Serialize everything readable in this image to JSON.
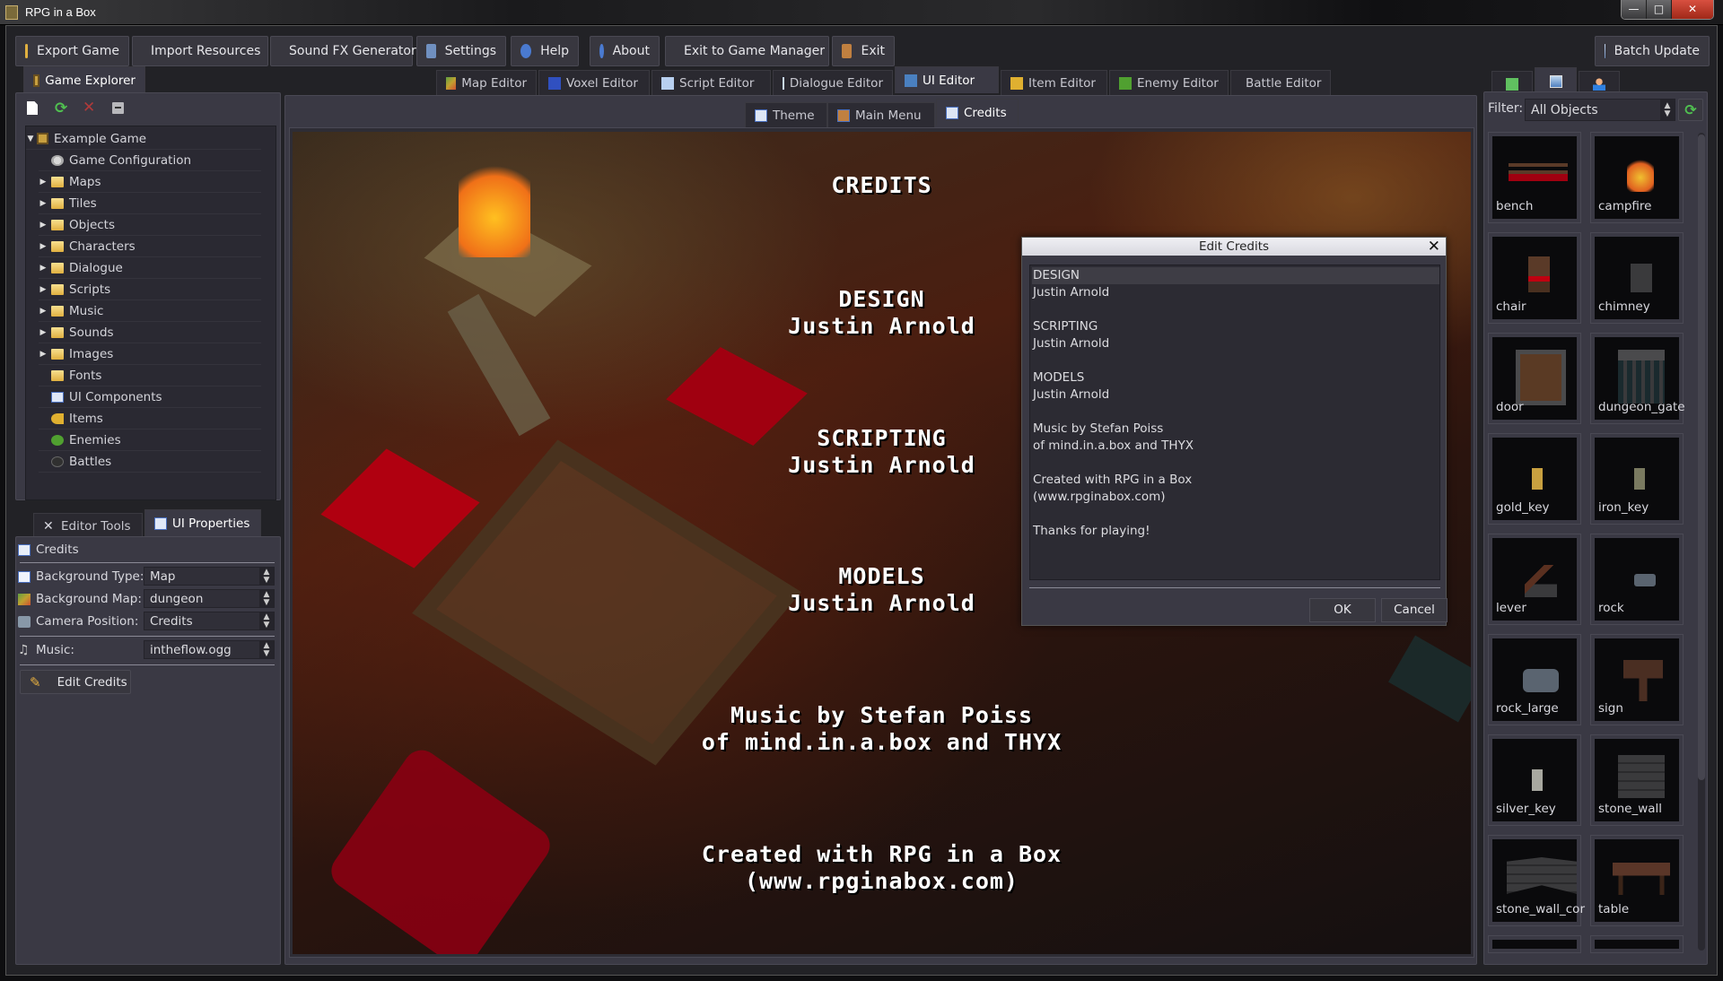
{
  "window": {
    "title": "RPG in a Box",
    "controls": {
      "minimize": "—",
      "maximize": "□",
      "close": "✕"
    }
  },
  "toolbar": {
    "buttons": [
      {
        "label": "Export Game",
        "icon": "package-icon",
        "color": "#e0b040"
      },
      {
        "label": "Import Resources",
        "icon": "import-icon",
        "color": "#e8c860"
      },
      {
        "label": "Sound FX Generator",
        "icon": "speaker-icon",
        "color": "#d04040"
      },
      {
        "label": "Settings",
        "icon": "settings-icon",
        "color": "#7090c0"
      },
      {
        "label": "Help",
        "icon": "help-icon",
        "color": "#4a7ad0"
      },
      {
        "label": "About",
        "icon": "info-icon",
        "color": "#4a7ad0"
      },
      {
        "label": "Exit to Game Manager",
        "icon": "game-manager-icon",
        "color": "#d0a040"
      },
      {
        "label": "Exit",
        "icon": "exit-door-icon",
        "color": "#c08040"
      }
    ],
    "batch_update": "Batch Update"
  },
  "left_tab": {
    "label": "Game Explorer"
  },
  "editor_tabs": [
    {
      "label": "Map Editor",
      "icon": "map-icon",
      "active": false
    },
    {
      "label": "Voxel Editor",
      "icon": "voxel-icon",
      "active": false
    },
    {
      "label": "Script Editor",
      "icon": "script-icon",
      "active": false
    },
    {
      "label": "Dialogue Editor",
      "icon": "dialogue-icon",
      "active": false
    },
    {
      "label": "UI Editor",
      "icon": "ui-icon",
      "active": true
    },
    {
      "label": "Item Editor",
      "icon": "key-icon",
      "active": false
    },
    {
      "label": "Enemy Editor",
      "icon": "bug-icon",
      "active": false
    },
    {
      "label": "Battle Editor",
      "icon": "bomb-icon",
      "active": false
    }
  ],
  "ui_subtabs": [
    {
      "label": "Theme",
      "active": false
    },
    {
      "label": "Main Menu",
      "active": false
    },
    {
      "label": "Credits",
      "active": true
    }
  ],
  "explorer": {
    "root": "Example Game",
    "items": [
      {
        "label": "Game Configuration",
        "type": "gear",
        "expandable": false
      },
      {
        "label": "Maps",
        "type": "folder",
        "expandable": true
      },
      {
        "label": "Tiles",
        "type": "folder",
        "expandable": true
      },
      {
        "label": "Objects",
        "type": "folder",
        "expandable": true
      },
      {
        "label": "Characters",
        "type": "folder",
        "expandable": true
      },
      {
        "label": "Dialogue",
        "type": "folder",
        "expandable": true
      },
      {
        "label": "Scripts",
        "type": "folder",
        "expandable": true
      },
      {
        "label": "Music",
        "type": "folder",
        "expandable": true
      },
      {
        "label": "Sounds",
        "type": "folder",
        "expandable": true
      },
      {
        "label": "Images",
        "type": "folder",
        "expandable": true
      },
      {
        "label": "Fonts",
        "type": "folder",
        "expandable": false
      },
      {
        "label": "UI Components",
        "type": "ui",
        "expandable": false
      },
      {
        "label": "Items",
        "type": "key",
        "expandable": false
      },
      {
        "label": "Enemies",
        "type": "bug",
        "expandable": false
      },
      {
        "label": "Battles",
        "type": "bomb",
        "expandable": false
      }
    ]
  },
  "bottom_tabs": [
    {
      "label": "Editor Tools",
      "active": false
    },
    {
      "label": "UI Properties",
      "active": true
    }
  ],
  "properties": {
    "header": "Credits",
    "background_type": {
      "label": "Background Type:",
      "value": "Map"
    },
    "background_map": {
      "label": "Background Map:",
      "value": "dungeon"
    },
    "camera_position": {
      "label": "Camera Position:",
      "value": "Credits"
    },
    "music": {
      "label": "Music:",
      "value": "intheflow.ogg"
    },
    "edit_button": "Edit Credits"
  },
  "preview": {
    "title": "CREDITS",
    "blocks": [
      [
        "DESIGN",
        "Justin Arnold"
      ],
      [
        "SCRIPTING",
        "Justin Arnold"
      ],
      [
        "MODELS",
        "Justin Arnold"
      ],
      [
        "Music by Stefan Poiss",
        "of mind.in.a.box and THYX"
      ],
      [
        "Created with RPG in a Box",
        "(www.rpginabox.com)"
      ]
    ]
  },
  "dialog": {
    "title": "Edit Credits",
    "lines": [
      "DESIGN",
      "Justin Arnold",
      "",
      "SCRIPTING",
      "Justin Arnold",
      "",
      "MODELS",
      "Justin Arnold",
      "",
      "Music by Stefan Poiss",
      "of mind.in.a.box and THYX",
      "",
      "Created with RPG in a Box",
      "(www.rpginabox.com)",
      "",
      "Thanks for playing!"
    ],
    "ok": "OK",
    "cancel": "Cancel"
  },
  "right_panel": {
    "tabs": [
      "tile-icon",
      "monitor-icon",
      "character-icon"
    ],
    "filter_label": "Filter:",
    "filter_value": "All Objects",
    "objects": [
      "bench",
      "campfire",
      "chair",
      "chimney",
      "door",
      "dungeon_gate",
      "gold_key",
      "iron_key",
      "lever",
      "rock",
      "rock_large",
      "sign",
      "silver_key",
      "stone_wall",
      "stone_wall_cor",
      "table",
      "",
      ""
    ]
  }
}
